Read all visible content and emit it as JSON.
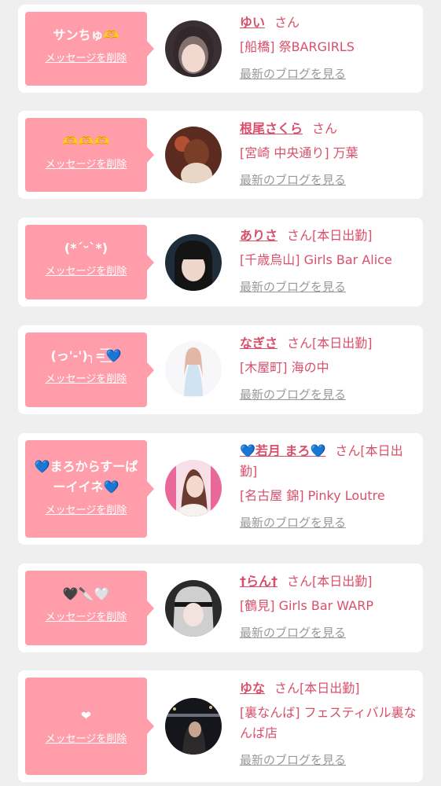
{
  "delete_label": "メッセージを削除",
  "blog_label": "最新のブログを見る",
  "colors": {
    "background": "#efefef",
    "card": "#ffffff",
    "bubble": "#ff9eaa",
    "accent_text": "#d94f6b",
    "muted_text": "#999999"
  },
  "cards": [
    {
      "message": "サンちゅ🫶",
      "name": "ゆい",
      "suffix": "さん",
      "shop": "[船橋] 祭BARGIRLS"
    },
    {
      "message": "🫶🫶🫶",
      "name": "根尾さくら",
      "suffix": "さん",
      "shop": "[宮崎 中央通り] 万葉"
    },
    {
      "message": "(*ˊᵕˋ*)",
      "name": "ありさ",
      "suffix": "さん[本日出勤]",
      "shop": "[千歳烏山] Girls Bar Alice"
    },
    {
      "message": "(っ'-')╮=͟͟͞͞💙",
      "name": "なぎさ",
      "suffix": "さん[本日出勤]",
      "shop": "[木屋町] 海の中"
    },
    {
      "message": "💙まろからすーぱーイイネ💙",
      "name": "💙若月 まろ💙",
      "suffix": "さん[本日出勤]",
      "shop": "[名古屋 錦] Pinky Loutre"
    },
    {
      "message": "🖤🔪🤍",
      "name": "†らん†",
      "suffix": "さん[本日出勤]",
      "shop": "[鶴見] Girls Bar WARP"
    },
    {
      "message": "❤",
      "name": "ゆな",
      "suffix": "さん[本日出勤]",
      "shop": "[裏なんば] フェスティバル裏なんば店"
    }
  ]
}
